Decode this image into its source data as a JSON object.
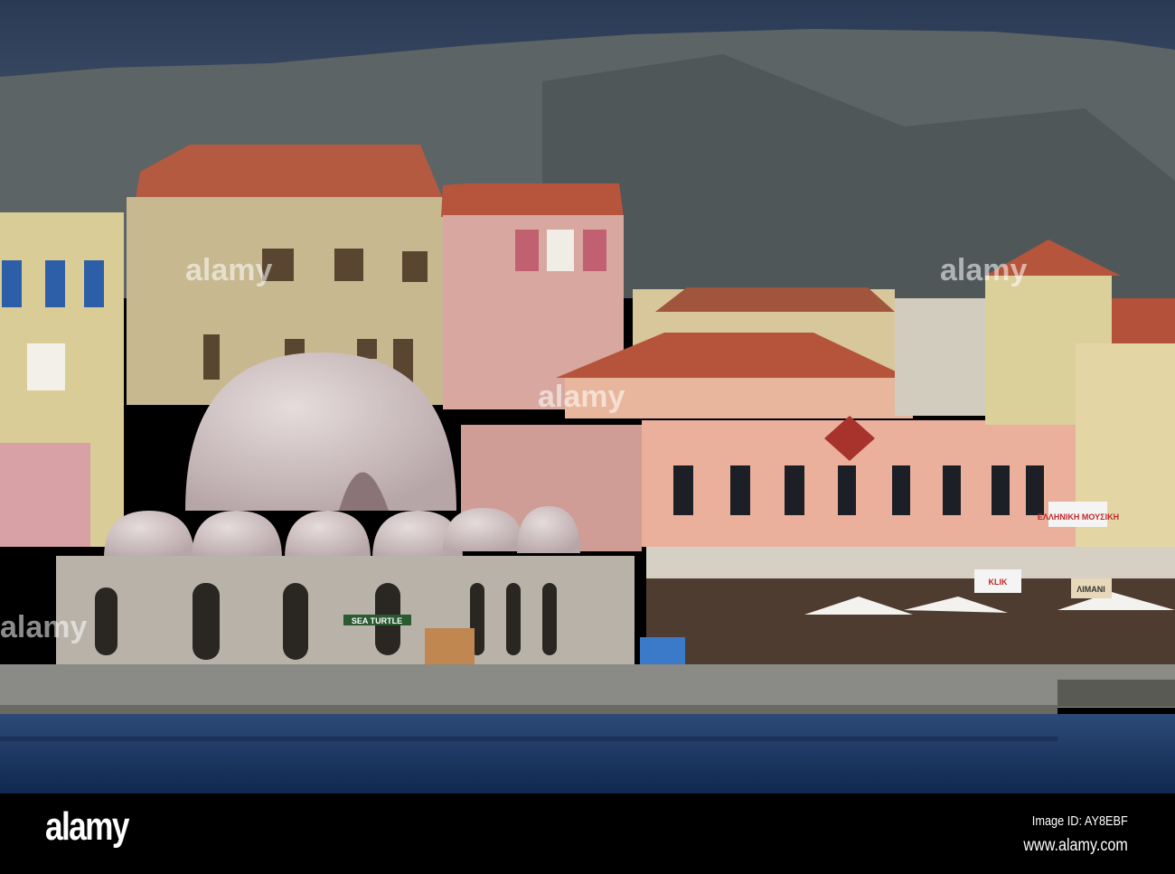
{
  "photo": {
    "watermark": "alamy",
    "signs": {
      "sea_turtle": "SEA TURTLE",
      "klik": "KLIK",
      "music": "ΕΛΛΗΝΙΚΗ ΜΟΥΣΙΚΗ",
      "limani": "ΛΙΜΑΝΙ"
    }
  },
  "footer": {
    "logo": "alamy",
    "image_id": "Image ID: AY8EBF",
    "url": "www.alamy.com"
  }
}
